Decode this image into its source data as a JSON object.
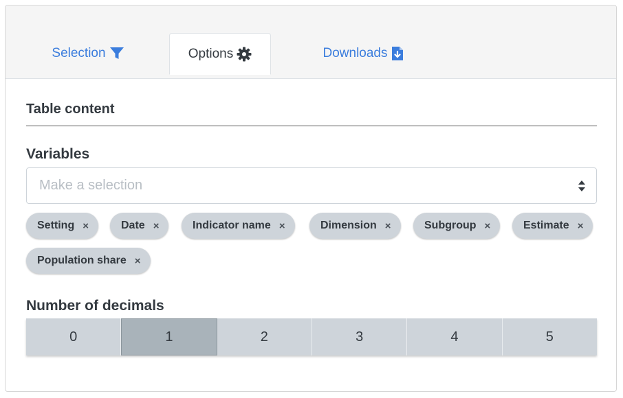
{
  "tabs": [
    {
      "label": "Selection",
      "icon": "filter-icon",
      "active": false
    },
    {
      "label": "Options",
      "icon": "gear-icon",
      "active": true
    },
    {
      "label": "Downloads",
      "icon": "file-download-icon",
      "active": false
    }
  ],
  "table_content": {
    "title": "Table content",
    "variables_label": "Variables",
    "select_placeholder": "Make a selection",
    "selected_variables": [
      "Setting",
      "Date",
      "Indicator name",
      "Dimension",
      "Subgroup",
      "Estimate",
      "Population share"
    ],
    "remove_glyph": "×",
    "decimals_label": "Number of decimals",
    "decimal_options": [
      "0",
      "1",
      "2",
      "3",
      "4",
      "5"
    ],
    "decimals_selected": "1"
  },
  "colors": {
    "link": "#3b7ddd",
    "chip_bg": "#ced4da",
    "selected_option_bg": "#a9b3ba"
  }
}
